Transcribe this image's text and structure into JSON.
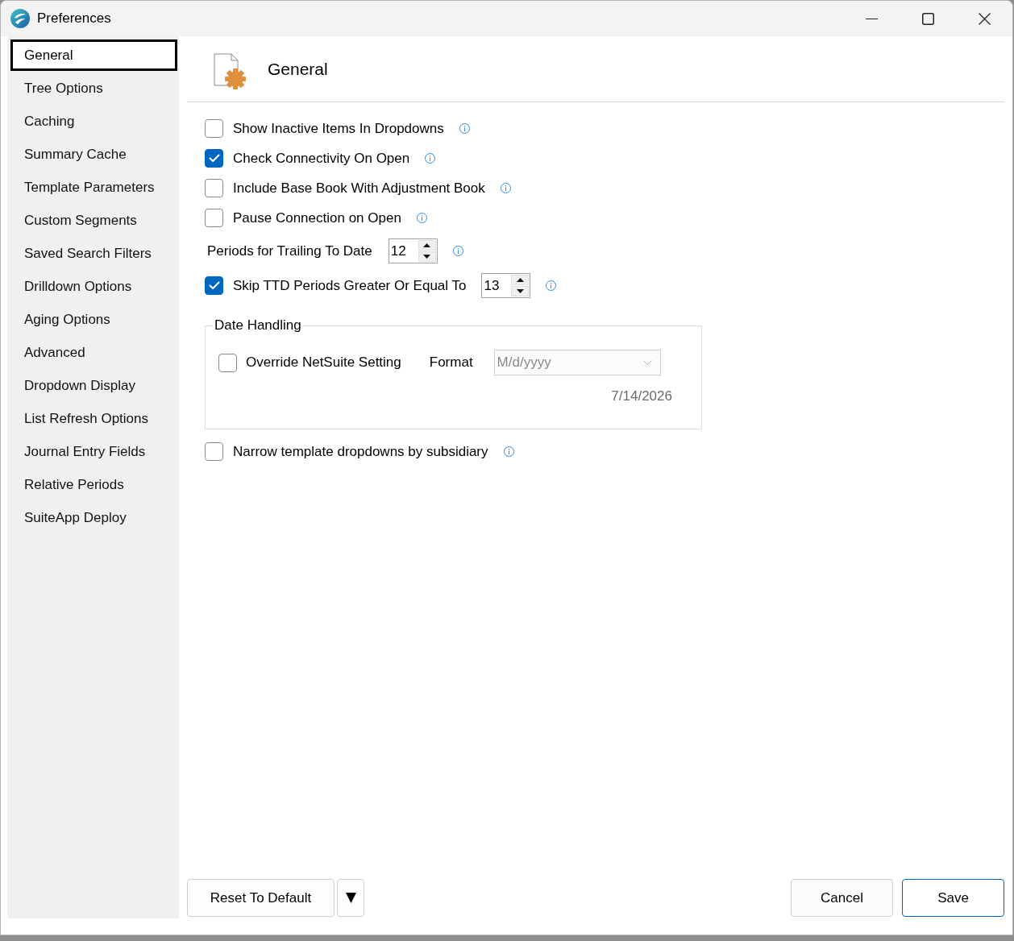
{
  "window": {
    "title": "Preferences"
  },
  "sidebar": {
    "items": [
      {
        "label": "General",
        "selected": true
      },
      {
        "label": "Tree Options",
        "selected": false
      },
      {
        "label": "Caching",
        "selected": false
      },
      {
        "label": "Summary Cache",
        "selected": false
      },
      {
        "label": "Template Parameters",
        "selected": false
      },
      {
        "label": "Custom Segments",
        "selected": false
      },
      {
        "label": "Saved Search Filters",
        "selected": false
      },
      {
        "label": "Drilldown Options",
        "selected": false
      },
      {
        "label": "Aging Options",
        "selected": false
      },
      {
        "label": "Advanced",
        "selected": false
      },
      {
        "label": "Dropdown Display",
        "selected": false
      },
      {
        "label": "List Refresh Options",
        "selected": false
      },
      {
        "label": "Journal Entry Fields",
        "selected": false
      },
      {
        "label": "Relative Periods",
        "selected": false
      },
      {
        "label": "SuiteApp Deploy",
        "selected": false
      }
    ]
  },
  "page": {
    "title": "General"
  },
  "options": [
    {
      "kind": "checkbox",
      "label": "Show Inactive Items In Dropdowns",
      "checked": false
    },
    {
      "kind": "checkbox",
      "label": "Check Connectivity On Open",
      "checked": true
    },
    {
      "kind": "checkbox",
      "label": "Include Base Book With Adjustment Book",
      "checked": false
    },
    {
      "kind": "checkbox",
      "label": "Pause Connection on Open",
      "checked": false
    },
    {
      "kind": "spinner",
      "label": "Periods for Trailing To Date",
      "value": "12"
    },
    {
      "kind": "checkbox_spinner",
      "label": "Skip TTD Periods Greater Or Equal To",
      "checked": true,
      "value": "13"
    }
  ],
  "date_handling": {
    "title": "Date Handling",
    "override": {
      "label": "Override NetSuite Setting",
      "checked": false
    },
    "format": {
      "label": "Format",
      "value": "M/d/yyyy",
      "disabled": true
    },
    "preview": "7/14/2026"
  },
  "more_options": [
    {
      "kind": "checkbox",
      "label": "Narrow template dropdowns by subsidiary",
      "checked": false
    }
  ],
  "footer": {
    "left": [
      {
        "label": "Reset To Default",
        "menu": true
      }
    ],
    "right": [
      {
        "label": "Cancel",
        "default": false
      },
      {
        "label": "Save",
        "default": true
      }
    ]
  }
}
